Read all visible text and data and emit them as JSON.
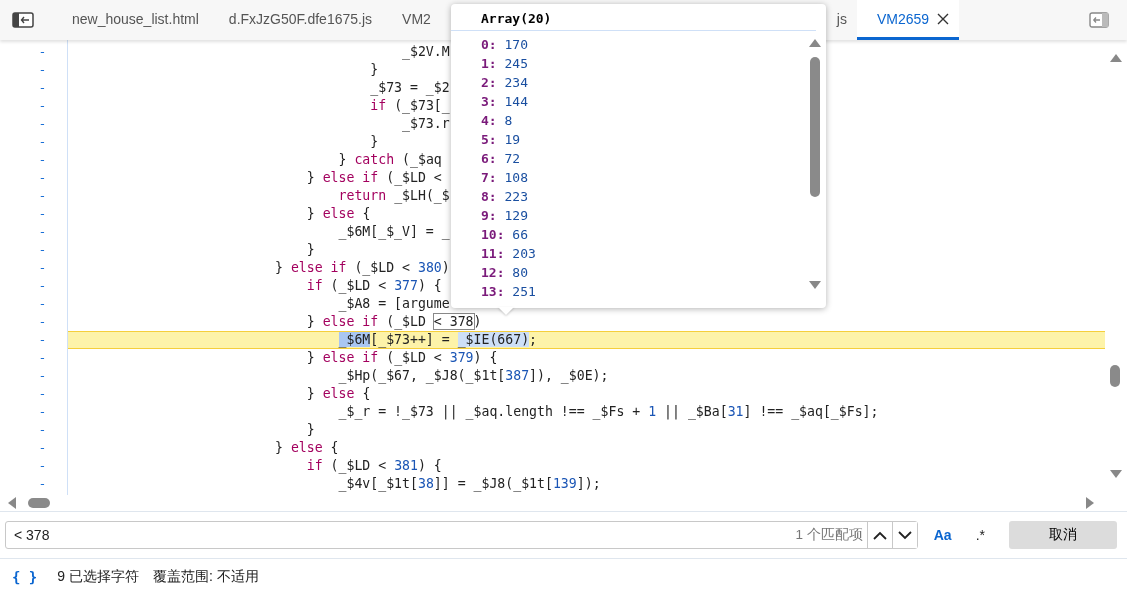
{
  "tabs": [
    {
      "label": "new_house_list.html",
      "selected": false
    },
    {
      "label": "d.FxJzG50F.dfe1675.js",
      "selected": false
    },
    {
      "label": "VM2",
      "selected": false
    },
    {
      "label": "js",
      "selected": false
    },
    {
      "label": "VM2659",
      "selected": true
    }
  ],
  "code_lines": [
    {
      "gutter": "-",
      "highlighted": false,
      "tokens": [
        {
          "kind": "plain",
          "text": "                _$2V.M"
        }
      ]
    },
    {
      "gutter": "-",
      "highlighted": false,
      "tokens": [
        {
          "kind": "plain",
          "text": "            }"
        }
      ]
    },
    {
      "gutter": "-",
      "highlighted": false,
      "tokens": [
        {
          "kind": "plain",
          "text": "            _$73 = _$2"
        }
      ]
    },
    {
      "gutter": "-",
      "highlighted": false,
      "tokens": [
        {
          "kind": "keyword",
          "text": "            if"
        },
        {
          "kind": "plain",
          "text": " (_$73[_"
        }
      ]
    },
    {
      "gutter": "-",
      "highlighted": false,
      "tokens": [
        {
          "kind": "plain",
          "text": "                _$73.r"
        }
      ]
    },
    {
      "gutter": "-",
      "highlighted": false,
      "tokens": [
        {
          "kind": "plain",
          "text": "            }"
        }
      ]
    },
    {
      "gutter": "-",
      "highlighted": false,
      "tokens": [
        {
          "kind": "plain",
          "text": "        } "
        },
        {
          "kind": "keyword",
          "text": "catch"
        },
        {
          "kind": "plain",
          "text": " (_$aq"
        }
      ]
    },
    {
      "gutter": "-",
      "highlighted": false,
      "tokens": [
        {
          "kind": "plain",
          "text": "    } "
        },
        {
          "kind": "keyword",
          "text": "else if"
        },
        {
          "kind": "plain",
          "text": " (_$LD <"
        }
      ]
    },
    {
      "gutter": "-",
      "highlighted": false,
      "tokens": [
        {
          "kind": "keyword",
          "text": "        return"
        },
        {
          "kind": "plain",
          "text": " _$LH(_$"
        }
      ]
    },
    {
      "gutter": "-",
      "highlighted": false,
      "tokens": [
        {
          "kind": "plain",
          "text": "    } "
        },
        {
          "kind": "keyword",
          "text": "else"
        },
        {
          "kind": "plain",
          "text": " {"
        }
      ]
    },
    {
      "gutter": "-",
      "highlighted": false,
      "tokens": [
        {
          "kind": "plain",
          "text": "        _$6M[_$_V] = _"
        }
      ]
    },
    {
      "gutter": "-",
      "highlighted": false,
      "tokens": [
        {
          "kind": "plain",
          "text": "    }"
        }
      ]
    },
    {
      "gutter": "-",
      "highlighted": false,
      "tokens": [
        {
          "kind": "plain",
          "text": "} "
        },
        {
          "kind": "keyword",
          "text": "else if"
        },
        {
          "kind": "plain",
          "text": " (_$LD < "
        },
        {
          "kind": "number",
          "text": "380"
        },
        {
          "kind": "plain",
          "text": ")"
        }
      ]
    },
    {
      "gutter": "-",
      "highlighted": false,
      "tokens": [
        {
          "kind": "keyword",
          "text": "    if"
        },
        {
          "kind": "plain",
          "text": " (_$LD < "
        },
        {
          "kind": "number",
          "text": "377"
        },
        {
          "kind": "plain",
          "text": ") {"
        }
      ]
    },
    {
      "gutter": "-",
      "highlighted": false,
      "tokens": [
        {
          "kind": "plain",
          "text": "        _$A8 = [argume"
        }
      ]
    },
    {
      "gutter": "-",
      "highlighted": false,
      "tokens": [
        {
          "kind": "plain",
          "text": "    } "
        },
        {
          "kind": "keyword",
          "text": "else if"
        },
        {
          "kind": "plain",
          "text": " (_$LD "
        },
        {
          "kind": "match",
          "text": "< 378"
        },
        {
          "kind": "plain",
          "text": ")"
        }
      ]
    },
    {
      "gutter": "-",
      "highlighted": true,
      "tokens": [
        {
          "kind": "selection",
          "text": "        _$6M"
        },
        {
          "kind": "plain",
          "text": "[_$73++] = "
        },
        {
          "kind": "selection-call",
          "text": "_$IE(667)"
        },
        {
          "kind": "plain",
          "text": ";"
        }
      ]
    },
    {
      "gutter": "-",
      "highlighted": false,
      "tokens": [
        {
          "kind": "plain",
          "text": "    } "
        },
        {
          "kind": "keyword",
          "text": "else if"
        },
        {
          "kind": "plain",
          "text": " (_$LD < "
        },
        {
          "kind": "number",
          "text": "379"
        },
        {
          "kind": "plain",
          "text": ") {"
        }
      ]
    },
    {
      "gutter": "-",
      "highlighted": false,
      "tokens": [
        {
          "kind": "plain",
          "text": "        _$Hp(_$67, _$J8(_$1t["
        },
        {
          "kind": "number",
          "text": "387"
        },
        {
          "kind": "plain",
          "text": "]), _$0E);"
        }
      ]
    },
    {
      "gutter": "-",
      "highlighted": false,
      "tokens": [
        {
          "kind": "plain",
          "text": "    } "
        },
        {
          "kind": "keyword",
          "text": "else"
        },
        {
          "kind": "plain",
          "text": " {"
        }
      ]
    },
    {
      "gutter": "-",
      "highlighted": false,
      "tokens": [
        {
          "kind": "plain",
          "text": "        _$_r = !_$73 || _$aq.length !== _$Fs + "
        },
        {
          "kind": "number",
          "text": "1"
        },
        {
          "kind": "plain",
          "text": " || _$Ba["
        },
        {
          "kind": "number",
          "text": "31"
        },
        {
          "kind": "plain",
          "text": "] !== _$aq[_$Fs];"
        }
      ]
    },
    {
      "gutter": "-",
      "highlighted": false,
      "tokens": [
        {
          "kind": "plain",
          "text": "    }"
        }
      ]
    },
    {
      "gutter": "-",
      "highlighted": false,
      "tokens": [
        {
          "kind": "plain",
          "text": "} "
        },
        {
          "kind": "keyword",
          "text": "else"
        },
        {
          "kind": "plain",
          "text": " {"
        }
      ]
    },
    {
      "gutter": "-",
      "highlighted": false,
      "tokens": [
        {
          "kind": "keyword",
          "text": "    if"
        },
        {
          "kind": "plain",
          "text": " (_$LD < "
        },
        {
          "kind": "number",
          "text": "381"
        },
        {
          "kind": "plain",
          "text": ") {"
        }
      ]
    },
    {
      "gutter": "-",
      "highlighted": false,
      "tokens": [
        {
          "kind": "plain",
          "text": "        _$4v[_$1t["
        },
        {
          "kind": "number",
          "text": "38"
        },
        {
          "kind": "plain",
          "text": "]] = _$J8(_$1t["
        },
        {
          "kind": "number",
          "text": "139"
        },
        {
          "kind": "plain",
          "text": "]);"
        }
      ]
    }
  ],
  "popover": {
    "title": "Array(20)",
    "items": [
      {
        "key": "0:",
        "value": "170"
      },
      {
        "key": "1:",
        "value": "245"
      },
      {
        "key": "2:",
        "value": "234"
      },
      {
        "key": "3:",
        "value": "144"
      },
      {
        "key": "4:",
        "value": "8"
      },
      {
        "key": "5:",
        "value": "19"
      },
      {
        "key": "6:",
        "value": "72"
      },
      {
        "key": "7:",
        "value": "108"
      },
      {
        "key": "8:",
        "value": "223"
      },
      {
        "key": "9:",
        "value": "129"
      },
      {
        "key": "10:",
        "value": "66"
      },
      {
        "key": "11:",
        "value": "203"
      },
      {
        "key": "12:",
        "value": "80"
      },
      {
        "key": "13:",
        "value": "251"
      }
    ]
  },
  "search": {
    "value": "< 378",
    "match_count": "1 个匹配项",
    "case_button": "Aa",
    "regex_button": ".*",
    "cancel_button": "取消"
  },
  "status_bar": {
    "format_icon": "{ }",
    "selection": "9 已选择字符",
    "coverage": "覆盖范围: 不适用"
  }
}
